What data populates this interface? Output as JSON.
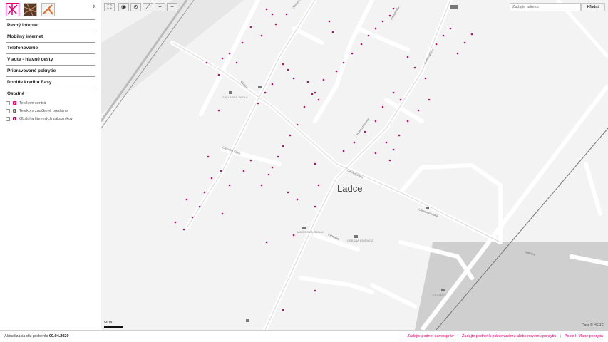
{
  "sidebar": {
    "menu": [
      "Pevný internet",
      "Mobilný internet",
      "Telefonovanie",
      "V aute - hlavné cesty",
      "Pripravované pokrytie",
      "Dobitie kreditu Easy"
    ],
    "legend_title": "Ostatné",
    "legend": [
      {
        "label": "Telekom centrá",
        "color": "#e20074"
      },
      {
        "label": "Telekom značkové predajne",
        "color": "#666666"
      },
      {
        "label": "Obsluha firemných zákazníkov",
        "color": "#b01060"
      }
    ]
  },
  "search": {
    "placeholder": "Zadajte adresu",
    "button": "Hľadať"
  },
  "map": {
    "town": "Ladce",
    "scale": "50 m",
    "credits": "Data © HERE",
    "streets": [
      "Jilemnického",
      "Partizánska",
      "Komenského",
      "Vážska",
      "Hviezdoslavova",
      "Ľudovíta Štúra",
      "Cementárska",
      "Cementárenská",
      "Záhradná",
      "Mierová"
    ],
    "pois": [
      "ZÁKLADNÁ ŠKOLA",
      "MATERSKÁ ŠKOLA",
      "OBECNÁ KNIŽNICA",
      "ZŠ LADCE"
    ],
    "accent": "#e20074"
  },
  "footer": {
    "updated_label": "Aktualizácia dát prebehla",
    "updated_date": "09.04.2020",
    "links": [
      "Zadajte podnet samospráv",
      "Zadajte podnet k plánovanému alebo novému pokrytiu",
      "Popis k Mape pokrytia"
    ]
  }
}
